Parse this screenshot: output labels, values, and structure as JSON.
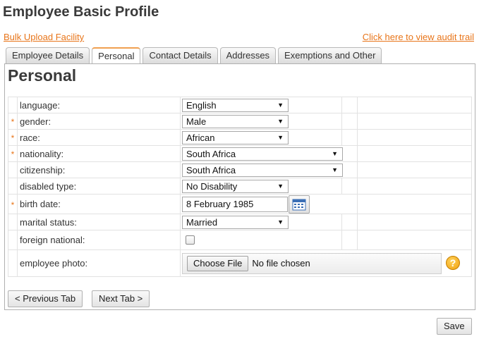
{
  "page": {
    "title": "Employee Basic Profile"
  },
  "links": {
    "bulk_upload": "Bulk Upload Facility",
    "audit_trail": "Click here to view audit trail"
  },
  "tabs": [
    {
      "label": "Employee Details",
      "active": false
    },
    {
      "label": "Personal",
      "active": true
    },
    {
      "label": "Contact Details",
      "active": false
    },
    {
      "label": "Addresses",
      "active": false
    },
    {
      "label": "Exemptions and Other",
      "active": false
    }
  ],
  "section": {
    "title": "Personal"
  },
  "required_marker": "*",
  "fields": {
    "language": {
      "label": "language:",
      "value": "English",
      "required": false
    },
    "gender": {
      "label": "gender:",
      "value": "Male",
      "required": true
    },
    "race": {
      "label": "race:",
      "value": "African",
      "required": true
    },
    "nationality": {
      "label": "nationality:",
      "value": "South Africa",
      "required": true
    },
    "citizenship": {
      "label": "citizenship:",
      "value": "South Africa",
      "required": false
    },
    "disabled_type": {
      "label": "disabled type:",
      "value": "No Disability",
      "required": false
    },
    "birth_date": {
      "label": "birth date:",
      "value": "8 February  1985",
      "required": true
    },
    "marital_status": {
      "label": "marital status:",
      "value": "Married",
      "required": false
    },
    "foreign_national": {
      "label": "foreign national:",
      "checked": false,
      "required": false
    },
    "employee_photo": {
      "label": "employee photo:",
      "button": "Choose File",
      "status": "No file chosen",
      "required": false
    }
  },
  "icons": {
    "dropdown": "▼",
    "calendar": "calendar-icon",
    "help": "?"
  },
  "nav": {
    "previous": "< Previous Tab",
    "next": "Next Tab >"
  },
  "actions": {
    "save": "Save"
  },
  "colors": {
    "accent": "#e8751a",
    "required": "#e8751a",
    "help": "#f0a010"
  }
}
